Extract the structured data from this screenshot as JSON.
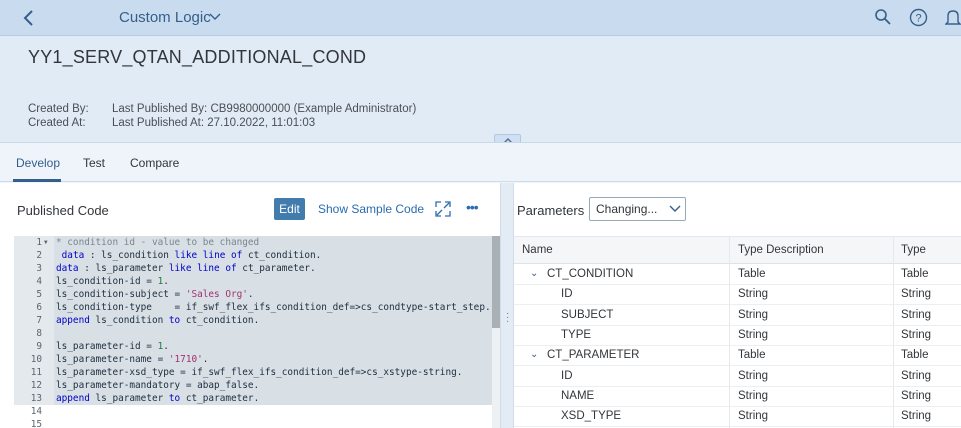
{
  "shell": {
    "title": "Custom Logic",
    "back_icon": "chevron-left-icon",
    "title_chevron": "chevron-down-icon",
    "icons": [
      "search-icon",
      "help-icon",
      "notification-icon"
    ]
  },
  "header": {
    "object_title": "YY1_SERV_QTAN_ADDITIONAL_COND",
    "created_by_label": "Created By:",
    "created_at_label": "Created At:",
    "last_published_by": "Last Published By: CB9980000000 (Example Administrator)",
    "last_published_at": "Last Published At: 27.10.2022, 11:01:03"
  },
  "tabs": [
    {
      "label": "Develop",
      "active": true
    },
    {
      "label": "Test",
      "active": false
    },
    {
      "label": "Compare",
      "active": false
    }
  ],
  "left_panel": {
    "title": "Published Code",
    "edit_label": "Edit",
    "sample_label": "Show Sample Code",
    "more_label": "•••"
  },
  "code_lines": [
    {
      "n": "1",
      "text": "* condition id - value to be changed"
    },
    {
      "n": "2",
      "text": " data : ls_condition like line of ct_condition."
    },
    {
      "n": "3",
      "text": "data : ls_parameter like line of ct_parameter."
    },
    {
      "n": "4",
      "text": "ls_condition-id = 1."
    },
    {
      "n": "5",
      "text": "ls_condition-subject = 'Sales Org'."
    },
    {
      "n": "6",
      "text": "ls_condition-type    = if_swf_flex_ifs_condition_def=>cs_condtype-start_step."
    },
    {
      "n": "7",
      "text": "append ls_condition to ct_condition."
    },
    {
      "n": "8",
      "text": ""
    },
    {
      "n": "9",
      "text": "ls_parameter-id = 1."
    },
    {
      "n": "10",
      "text": "ls_parameter-name = '1710'."
    },
    {
      "n": "11",
      "text": "ls_parameter-xsd_type = if_swf_flex_ifs_condition_def=>cs_xstype-string."
    },
    {
      "n": "12",
      "text": "ls_parameter-mandatory = abap_false."
    },
    {
      "n": "13",
      "text": "append ls_parameter to ct_parameter."
    },
    {
      "n": "14",
      "text": ""
    },
    {
      "n": "15",
      "text": ""
    }
  ],
  "right_panel": {
    "title": "Parameters",
    "select_value": "Changing...",
    "columns": [
      "Name",
      "Type Description",
      "Type"
    ],
    "rows": [
      {
        "name": "CT_CONDITION",
        "desc": "Table",
        "type": "Table",
        "group": true
      },
      {
        "name": "ID",
        "desc": "String",
        "type": "String",
        "group": false
      },
      {
        "name": "SUBJECT",
        "desc": "String",
        "type": "String",
        "group": false
      },
      {
        "name": "TYPE",
        "desc": "String",
        "type": "String",
        "group": false
      },
      {
        "name": "CT_PARAMETER",
        "desc": "Table",
        "type": "Table",
        "group": true
      },
      {
        "name": "ID",
        "desc": "String",
        "type": "String",
        "group": false
      },
      {
        "name": "NAME",
        "desc": "String",
        "type": "String",
        "group": false
      },
      {
        "name": "XSD_TYPE",
        "desc": "String",
        "type": "String",
        "group": false
      }
    ]
  }
}
